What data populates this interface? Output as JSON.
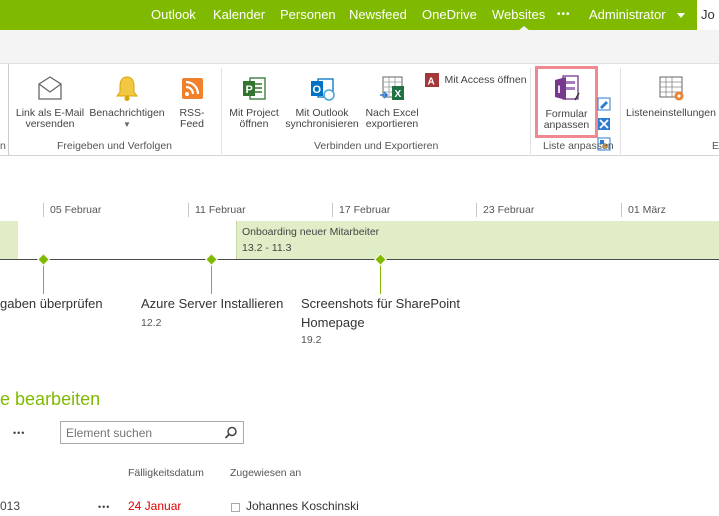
{
  "suitebar": {
    "nav": [
      "Outlook",
      "Kalender",
      "Personen",
      "Newsfeed",
      "OneDrive",
      "Websites"
    ],
    "more": "•••",
    "user": "Administrator",
    "user_cut": "Jo",
    "color": "#7fba00"
  },
  "ribbon": {
    "groups": {
      "share": "Freigeben und Verfolgen",
      "connect": "Verbinden und Exportieren",
      "list": "Liste anpassen",
      "settings_cut": "E"
    },
    "buttons": {
      "email_link_1": "Link als E-Mail",
      "email_link_2": "versenden",
      "notify": "Benachrichtigen",
      "rss": "RSS-Feed",
      "project_1": "Mit Project",
      "project_2": "öffnen",
      "outlook_1": "Mit Outlook",
      "outlook_2": "synchronisieren",
      "excel_1": "Nach Excel",
      "excel_2": "exportieren",
      "access": "Mit Access öffnen",
      "form_1": "Formular",
      "form_2": "anpassen",
      "list_settings": "Listeneinstellungen"
    },
    "highlight_color": "#f0898f"
  },
  "timeline": {
    "ticks": [
      "05 Februar",
      "11 Februar",
      "17 Februar",
      "23 Februar",
      "01 März"
    ],
    "bar_title": "Onboarding neuer Mitarbeiter",
    "bar_dates": "13.2 - 11.3",
    "tasks": [
      {
        "title": "gaben überprüfen",
        "date": ""
      },
      {
        "title": "Azure Server Installieren",
        "date": "12.2"
      },
      {
        "title_1": "Screenshots für SharePoint",
        "title_2": "Homepage",
        "date": "19.2"
      }
    ]
  },
  "list": {
    "edit_prefix": "e",
    "edit_link": "bearbeiten",
    "more": "•••",
    "search_placeholder": "Element suchen",
    "columns": [
      "Fälligkeitsdatum",
      "Zugewiesen an"
    ],
    "rows": [
      {
        "id_cut": "013",
        "more": "•••",
        "due": "24 Januar",
        "assigned": "Johannes Koschinski"
      }
    ]
  }
}
